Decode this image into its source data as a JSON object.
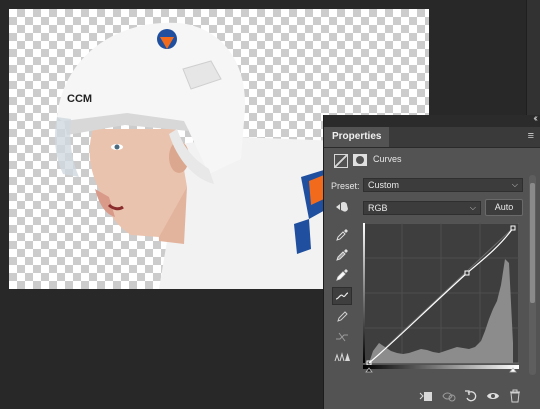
{
  "panel": {
    "tab_label": "Properties",
    "adjustment_title": "Curves",
    "preset_label": "Preset:",
    "preset_value": "Custom",
    "channel_value": "RGB",
    "auto_label": "Auto"
  },
  "icons": {
    "curves_adjustment": "curves-adjustment-icon",
    "mask": "mask-icon",
    "on_image": "on-image-adjust-icon",
    "eyedroppers": [
      "black-point-eyedropper-icon",
      "gray-point-eyedropper-icon",
      "white-point-eyedropper-icon"
    ],
    "tools": [
      "curve-edit-icon",
      "pencil-icon",
      "smooth-icon",
      "clipping-warning-icon"
    ],
    "bottom": [
      "clip-to-layer-icon",
      "previous-state-icon",
      "reset-icon",
      "visibility-eye-icon",
      "trash-icon"
    ]
  },
  "colors": {
    "panel_bg": "#535353",
    "workspace_bg": "#282828",
    "curve": "#ffffff",
    "histogram": "#8c8c8c"
  }
}
